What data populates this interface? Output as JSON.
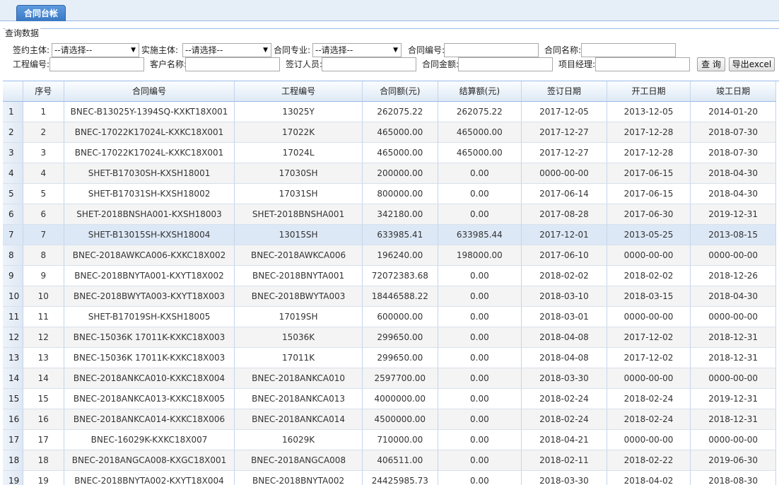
{
  "tab": {
    "title": "合同台帐"
  },
  "query": {
    "title": "查询数据",
    "sign_subject_label": "签约主体:",
    "sign_subject_value": "--请选择--",
    "impl_subject_label": "实施主体:",
    "impl_subject_value": "--请选择--",
    "contract_major_label": "合同专业:",
    "contract_major_value": "--请选择--",
    "contract_no_label": "合同编号:",
    "contract_no_value": "",
    "contract_name_label": "合同名称:",
    "contract_name_value": "",
    "project_no_label": "工程编号:",
    "project_no_value": "",
    "customer_label": "客户名称:",
    "customer_value": "",
    "signer_label": "签订人员:",
    "signer_value": "",
    "amount_label": "合同金额:",
    "amount_value": "",
    "pm_label": "项目经理:",
    "pm_value": "",
    "search_button": "查 询",
    "export_button": "导出excel"
  },
  "table": {
    "columns": [
      "",
      "序号",
      "合同编号",
      "工程编号",
      "合同额(元)",
      "结算额(元)",
      "签订日期",
      "开工日期",
      "竣工日期"
    ],
    "rows": [
      {
        "rn": "1",
        "seq": "1",
        "contract_no": "BNEC-B13025Y-1394SQ-KXKT18X001",
        "project_no": "13025Y",
        "amount": "262075.22",
        "settled": "262075.22",
        "sign_date": "2017-12-05",
        "start_date": "2013-12-05",
        "end_date": "2014-01-20"
      },
      {
        "rn": "2",
        "seq": "2",
        "contract_no": "BNEC-17022K17024L-KXKC18X001",
        "project_no": "17022K",
        "amount": "465000.00",
        "settled": "465000.00",
        "sign_date": "2017-12-27",
        "start_date": "2017-12-28",
        "end_date": "2018-07-30"
      },
      {
        "rn": "3",
        "seq": "3",
        "contract_no": "BNEC-17022K17024L-KXKC18X001",
        "project_no": "17024L",
        "amount": "465000.00",
        "settled": "465000.00",
        "sign_date": "2017-12-27",
        "start_date": "2017-12-28",
        "end_date": "2018-07-30"
      },
      {
        "rn": "4",
        "seq": "4",
        "contract_no": "SHET-B17030SH-KXSH18001",
        "project_no": "17030SH",
        "amount": "200000.00",
        "settled": "0.00",
        "sign_date": "0000-00-00",
        "start_date": "2017-06-15",
        "end_date": "2018-04-30"
      },
      {
        "rn": "5",
        "seq": "5",
        "contract_no": "SHET-B17031SH-KXSH18002",
        "project_no": "17031SH",
        "amount": "800000.00",
        "settled": "0.00",
        "sign_date": "2017-06-14",
        "start_date": "2017-06-15",
        "end_date": "2018-04-30"
      },
      {
        "rn": "6",
        "seq": "6",
        "contract_no": "SHET-2018BNSHA001-KXSH18003",
        "project_no": "SHET-2018BNSHA001",
        "amount": "342180.00",
        "settled": "0.00",
        "sign_date": "2017-08-28",
        "start_date": "2017-06-30",
        "end_date": "2019-12-31"
      },
      {
        "rn": "7",
        "seq": "7",
        "contract_no": "SHET-B13015SH-KXSH18004",
        "project_no": "13015SH",
        "amount": "633985.41",
        "settled": "633985.44",
        "sign_date": "2017-12-01",
        "start_date": "2013-05-25",
        "end_date": "2013-08-15"
      },
      {
        "rn": "8",
        "seq": "8",
        "contract_no": "BNEC-2018AWKCA006-KXKC18X002",
        "project_no": "BNEC-2018AWKCA006",
        "amount": "196240.00",
        "settled": "198000.00",
        "sign_date": "2017-06-10",
        "start_date": "0000-00-00",
        "end_date": "0000-00-00"
      },
      {
        "rn": "9",
        "seq": "9",
        "contract_no": "BNEC-2018BNYTA001-KXYT18X002",
        "project_no": "BNEC-2018BNYTA001",
        "amount": "72072383.68",
        "settled": "0.00",
        "sign_date": "2018-02-02",
        "start_date": "2018-02-02",
        "end_date": "2018-12-26"
      },
      {
        "rn": "10",
        "seq": "10",
        "contract_no": "BNEC-2018BWYTA003-KXYT18X003",
        "project_no": "BNEC-2018BWYTA003",
        "amount": "18446588.22",
        "settled": "0.00",
        "sign_date": "2018-03-10",
        "start_date": "2018-03-15",
        "end_date": "2018-04-30"
      },
      {
        "rn": "11",
        "seq": "11",
        "contract_no": "SHET-B17019SH-KXSH18005",
        "project_no": "17019SH",
        "amount": "600000.00",
        "settled": "0.00",
        "sign_date": "2018-03-01",
        "start_date": "0000-00-00",
        "end_date": "0000-00-00"
      },
      {
        "rn": "12",
        "seq": "12",
        "contract_no": "BNEC-15036K 17011K-KXKC18X003",
        "project_no": "15036K",
        "amount": "299650.00",
        "settled": "0.00",
        "sign_date": "2018-04-08",
        "start_date": "2017-12-02",
        "end_date": "2018-12-31"
      },
      {
        "rn": "13",
        "seq": "13",
        "contract_no": "BNEC-15036K 17011K-KXKC18X003",
        "project_no": "17011K",
        "amount": "299650.00",
        "settled": "0.00",
        "sign_date": "2018-04-08",
        "start_date": "2017-12-02",
        "end_date": "2018-12-31"
      },
      {
        "rn": "14",
        "seq": "14",
        "contract_no": "BNEC-2018ANKCA010-KXKC18X004",
        "project_no": "BNEC-2018ANKCA010",
        "amount": "2597700.00",
        "settled": "0.00",
        "sign_date": "2018-03-30",
        "start_date": "0000-00-00",
        "end_date": "0000-00-00"
      },
      {
        "rn": "15",
        "seq": "15",
        "contract_no": "BNEC-2018ANKCA013-KXKC18X005",
        "project_no": "BNEC-2018ANKCA013",
        "amount": "4000000.00",
        "settled": "0.00",
        "sign_date": "2018-02-24",
        "start_date": "2018-02-24",
        "end_date": "2019-12-31"
      },
      {
        "rn": "16",
        "seq": "16",
        "contract_no": "BNEC-2018ANKCA014-KXKC18X006",
        "project_no": "BNEC-2018ANKCA014",
        "amount": "4500000.00",
        "settled": "0.00",
        "sign_date": "2018-02-24",
        "start_date": "2018-02-24",
        "end_date": "2018-12-31"
      },
      {
        "rn": "17",
        "seq": "17",
        "contract_no": "BNEC-16029K-KXKC18X007",
        "project_no": "16029K",
        "amount": "710000.00",
        "settled": "0.00",
        "sign_date": "2018-04-21",
        "start_date": "0000-00-00",
        "end_date": "0000-00-00"
      },
      {
        "rn": "18",
        "seq": "18",
        "contract_no": "BNEC-2018ANGCA008-KXGC18X001",
        "project_no": "BNEC-2018ANGCA008",
        "amount": "406511.00",
        "settled": "0.00",
        "sign_date": "2018-02-11",
        "start_date": "2018-02-22",
        "end_date": "2019-06-30"
      },
      {
        "rn": "19",
        "seq": "19",
        "contract_no": "BNEC-2018BNYTA002-KXYT18X004",
        "project_no": "BNEC-2018BNYTA002",
        "amount": "24425985.73",
        "settled": "0.00",
        "sign_date": "2018-03-30",
        "start_date": "2018-04-02",
        "end_date": "2018-08-30"
      }
    ]
  },
  "colors": {
    "redaction": "#ee2c2c",
    "tab": "#3a78c3",
    "selected_row": "#dde8f6"
  }
}
